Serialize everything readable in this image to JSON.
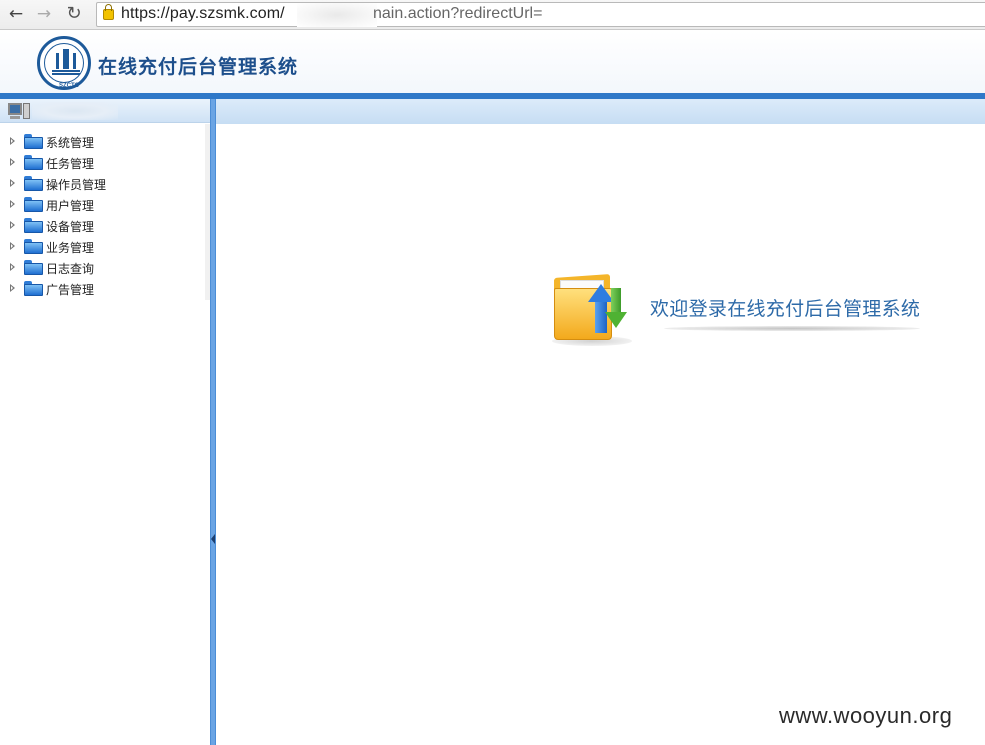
{
  "browser": {
    "url_prefix": "https://pay.szsmk.com/",
    "url_suffix": "nain.action?redirectUrl=",
    "back_icon": "arrow-left",
    "forward_icon": "arrow-right",
    "reload_icon": "reload"
  },
  "header": {
    "title": "在线充付后台管理系统",
    "logo_text": "SZCTC"
  },
  "sidebar": {
    "items": [
      {
        "label": "系统管理"
      },
      {
        "label": "任务管理"
      },
      {
        "label": "操作员管理"
      },
      {
        "label": "用户管理"
      },
      {
        "label": "设备管理"
      },
      {
        "label": "业务管理"
      },
      {
        "label": "日志查询"
      },
      {
        "label": "广告管理"
      }
    ]
  },
  "main": {
    "welcome_text": "欢迎登录在线充付后台管理系统"
  },
  "watermark": "www.wooyun.org",
  "colors": {
    "accent": "#2f78c8",
    "title": "#1d4f8c",
    "welcome": "#2d6aa8"
  }
}
